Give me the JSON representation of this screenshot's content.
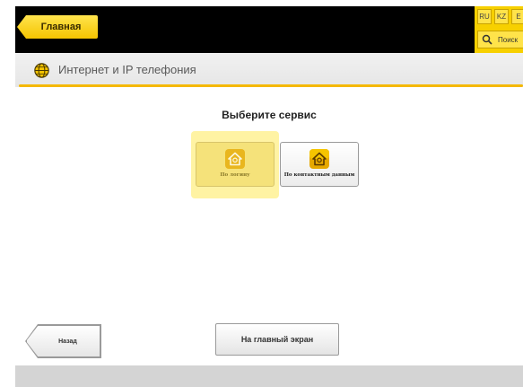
{
  "header": {
    "home_label": "Главная",
    "languages": [
      "RU",
      "KZ",
      "E"
    ],
    "search_label": "Поиск"
  },
  "titlebar": {
    "title": "Интернет и IP телефония",
    "icon": "globe-icon"
  },
  "main": {
    "heading": "Выберите сервис",
    "services": [
      {
        "label": "По логину",
        "icon": "house-at-icon",
        "selected": true
      },
      {
        "label": "По контактным данным",
        "icon": "house-at-icon",
        "selected": false
      }
    ]
  },
  "bottom": {
    "back_label": "Назад",
    "main_screen_label": "На главный экран"
  },
  "colors": {
    "accent": "#f5c400",
    "topbar": "#000000",
    "footer": "#d4d4d4"
  }
}
